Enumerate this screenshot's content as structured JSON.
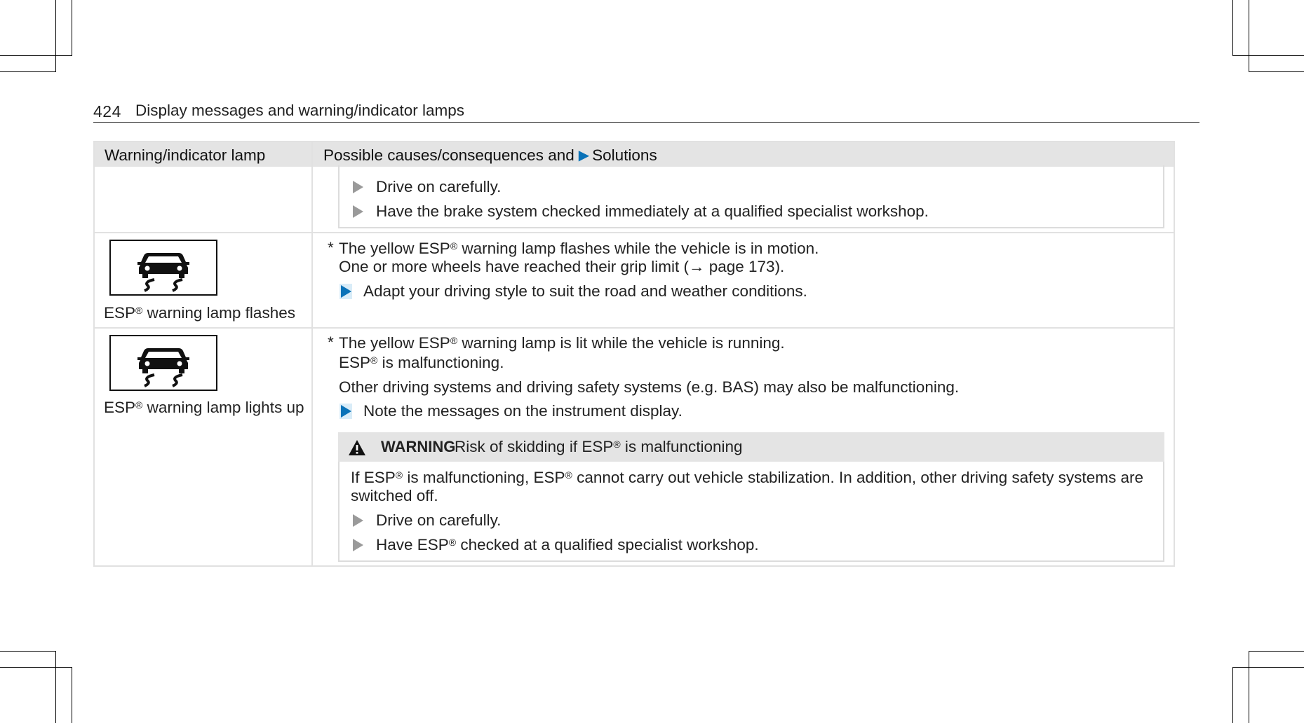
{
  "header": {
    "page_number": "424",
    "title": "Display messages and warning/indicator lamps"
  },
  "table": {
    "col1_header": "Warning/indicator lamp",
    "col2_header_a": "Possible causes/consequences and",
    "col2_header_b": "Solutions",
    "row1": {
      "step1": "Drive on carefully.",
      "step2": "Have the brake system checked immediately at a qualified specialist workshop."
    },
    "row2": {
      "lamp_icon": "esp-skid-car-icon",
      "lamp_label_a": "ESP",
      "lamp_label_sup": "®",
      "lamp_label_b": " warning lamp flashes",
      "star": "*",
      "cause_a": "The yellow ESP",
      "cause_sup": "®",
      "cause_b": " warning lamp flashes while the vehicle is in motion.",
      "cause_line2": "One or more wheels have reached their grip limit (→ page 173).",
      "action": "Adapt your driving style to suit the road and weather conditions."
    },
    "row3": {
      "lamp_icon": "esp-skid-car-icon",
      "lamp_label_a": "ESP",
      "lamp_label_sup": "®",
      "lamp_label_b": " warning lamp lights up",
      "star": "*",
      "cause_a": "The yellow ESP",
      "cause_sup": "®",
      "cause_b": " warning lamp is lit while the vehicle is running.",
      "cause2_a": "ESP",
      "cause2_sup": "®",
      "cause2_b": " is malfunctioning.",
      "cause3": "Other driving systems and driving safety systems (e.g. BAS) may also be malfunctioning.",
      "action": "Note the messages on the instrument display.",
      "warning": {
        "icon": "warning-triangle-icon",
        "label": "WARNING",
        "title_a": "Risk of skidding if ESP",
        "title_sup": "®",
        "title_b": " is malfunctioning",
        "body_a": "If ESP",
        "body_sup1": "®",
        "body_b": " is malfunctioning, ESP",
        "body_sup2": "®",
        "body_c": " cannot carry out vehicle stabilization. In addition, other driving safety systems are",
        "body_line2": "switched off.",
        "step1": "Drive on carefully.",
        "step2_a": "Have ESP",
        "step2_sup": "®",
        "step2_b": " checked at a qualified specialist workshop."
      }
    }
  },
  "colors": {
    "accent": "#0a72b8",
    "header_bg": "#e4e4e4",
    "border": "#e1e1e1"
  }
}
